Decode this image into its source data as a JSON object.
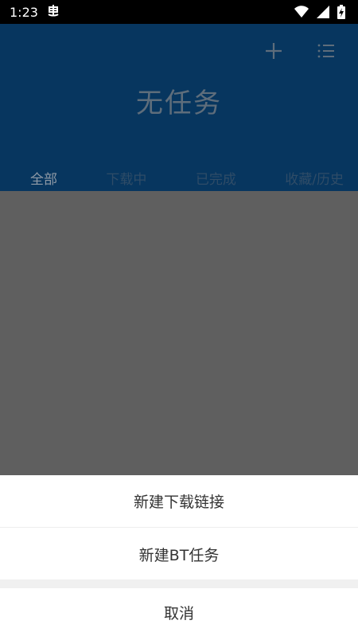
{
  "status_bar": {
    "time": "1:23",
    "notification_icon": "bug-notification-icon",
    "icons": [
      "wifi-icon",
      "signal-icon",
      "battery-charging-icon"
    ]
  },
  "header": {
    "title": "无任务",
    "actions": [
      "plus-icon",
      "menu-list-icon"
    ]
  },
  "tabs": [
    {
      "label": "全部",
      "active": true
    },
    {
      "label": "下载中",
      "active": false
    },
    {
      "label": "已完成",
      "active": false
    },
    {
      "label": "收藏/历史",
      "active": false
    }
  ],
  "bottom_sheet": {
    "items": [
      {
        "label": "新建下载链接"
      },
      {
        "label": "新建BT任务"
      }
    ],
    "cancel_label": "取消"
  },
  "colors": {
    "header_bg": "#07365f",
    "overlay": "#5f5f5f",
    "sheet_bg": "#ffffff"
  }
}
